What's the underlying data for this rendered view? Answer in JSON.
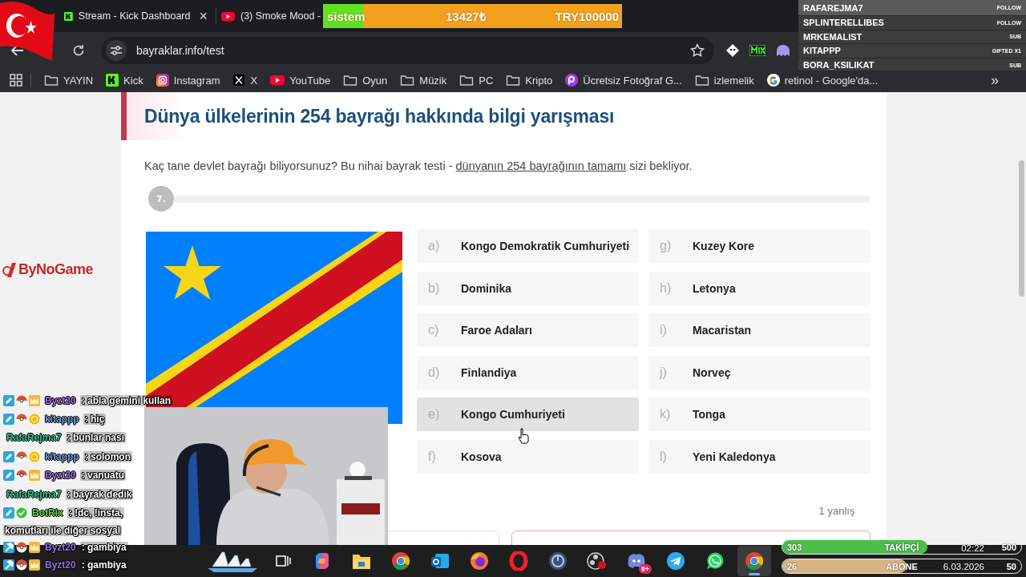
{
  "browser": {
    "tabs": [
      {
        "title": "Stream - Kick Dashboard",
        "close": "×",
        "kind": "kick"
      },
      {
        "title": "(3) Smoke Mood -",
        "kind": "youtube"
      }
    ],
    "address": "bayraklar.info/test",
    "bookmarks": [
      {
        "label": "YAYIN",
        "kind": "folder"
      },
      {
        "label": "Kick",
        "kind": "kick"
      },
      {
        "label": "Instagram",
        "kind": "instagram"
      },
      {
        "label": "X",
        "kind": "x"
      },
      {
        "label": "YouTube",
        "kind": "youtube"
      },
      {
        "label": "Oyun",
        "kind": "folder"
      },
      {
        "label": "Müzik",
        "kind": "folder"
      },
      {
        "label": "PC",
        "kind": "folder"
      },
      {
        "label": "Kripto",
        "kind": "folder"
      },
      {
        "label": "Ücretsiz Fotoğraf G...",
        "kind": "picsart"
      },
      {
        "label": "izlemelik",
        "kind": "folder"
      },
      {
        "label": "retinol - Google'da...",
        "kind": "google"
      }
    ],
    "more": "»"
  },
  "quiz": {
    "title": "Dünya ülkelerinin 254 bayrağı hakkında bilgi yarışması",
    "intro": "Kaç tane devlet bayrağı biliyorsunuz? Bu nihai bayrak testi - ",
    "intro_link": "dünyanın 254 bayrağının tamamı",
    "intro_end": " sizi bekliyor.",
    "step": "7.",
    "options": [
      {
        "letter": "a)",
        "name": "Kongo Demokratik Cumhuriyeti",
        "highlighted": false
      },
      {
        "letter": "b)",
        "name": "Dominika",
        "highlighted": false
      },
      {
        "letter": "c)",
        "name": "Faroe Adaları",
        "highlighted": false
      },
      {
        "letter": "d)",
        "name": "Finlandiya",
        "highlighted": false
      },
      {
        "letter": "e)",
        "name": "Kongo Cumhuriyeti",
        "highlighted": true
      },
      {
        "letter": "f)",
        "name": "Kosova",
        "highlighted": false
      },
      {
        "letter": "g)",
        "name": "Kuzey Kore",
        "highlighted": false
      },
      {
        "letter": "h)",
        "name": "Letonya",
        "highlighted": false
      },
      {
        "letter": "i)",
        "name": "Macaristan",
        "highlighted": false
      },
      {
        "letter": "j)",
        "name": "Norveç",
        "highlighted": false
      },
      {
        "letter": "k)",
        "name": "Tonga",
        "highlighted": false
      },
      {
        "letter": "l)",
        "name": "Yeni Kaledonya",
        "highlighted": false
      }
    ],
    "mistakes": "1 yanlış"
  },
  "taskbar": {
    "apps": [
      {
        "kind": "widget",
        "active": false
      },
      {
        "kind": "taskview",
        "active": false
      },
      {
        "kind": "copilot",
        "active": false
      },
      {
        "kind": "explorer",
        "active": false
      },
      {
        "kind": "chrome",
        "active": false
      },
      {
        "kind": "outlook",
        "active": false
      },
      {
        "kind": "firefox",
        "active": false
      },
      {
        "kind": "opera",
        "active": false
      },
      {
        "kind": "disc",
        "active": false
      },
      {
        "kind": "obs",
        "active": false
      },
      {
        "kind": "discord",
        "active": false,
        "badge": "9+"
      },
      {
        "kind": "telegram",
        "active": false
      },
      {
        "kind": "whatsapp",
        "active": false
      },
      {
        "kind": "chrome",
        "active": true
      }
    ],
    "time": "02:22",
    "date": "6.03.2026"
  },
  "overlay": {
    "goal": {
      "label": "sistem",
      "amount": "13427₺",
      "target": "TRY100000",
      "level": 0.134
    },
    "events": [
      {
        "name": "RAFAREJMA7",
        "type": "FOLLOW"
      },
      {
        "name": "SPLINTERELLIBES",
        "type": "FOLLOW"
      },
      {
        "name": "MRKEMALIST",
        "type": "SUB"
      },
      {
        "name": "KITAPPP",
        "type": "GIFTED X1"
      },
      {
        "name": "BORA_KSILIKAT",
        "type": "SUB"
      }
    ],
    "logo": "ByNoGame",
    "chat": [
      {
        "user": "Byzt20",
        "color": "#9a6fe0",
        "badges": [
          {
            "kind": "pencil"
          },
          {
            "kind": "ball"
          },
          {
            "kind": "crown"
          }
        ],
        "text": ": abla gemini kullan"
      },
      {
        "user": "kitappp",
        "color": "#6f9be0",
        "badges": [
          {
            "kind": "pencil"
          },
          {
            "kind": "ball"
          },
          {
            "kind": "coin"
          }
        ],
        "text": ": hiç"
      },
      {
        "user": "RafaRejma7",
        "color": "#3fbf8f",
        "text": ": bunlar nası"
      },
      {
        "user": "kitappp",
        "color": "#6f9be0",
        "badges": [
          {
            "kind": "pencil"
          },
          {
            "kind": "ball"
          },
          {
            "kind": "coin"
          }
        ],
        "text": ": solomon"
      },
      {
        "user": "Byzt20",
        "color": "#9a6fe0",
        "badges": [
          {
            "kind": "pencil"
          },
          {
            "kind": "ball"
          },
          {
            "kind": "crown"
          }
        ],
        "text": ": vanuatu"
      },
      {
        "user": "RafaRejma7",
        "color": "#3fbf8f",
        "text": ": bayrak dedik"
      },
      {
        "user": "BotRix",
        "color": "#5fd43a",
        "badges": [
          {
            "kind": "pencil"
          },
          {
            "kind": "check"
          }
        ],
        "text": ": !dc, !insta,",
        "continuation": "komutları ile diğer sosyal"
      },
      {
        "user": "Byzt20",
        "color": "#9a6fe0",
        "badges": [
          {
            "kind": "hammer"
          },
          {
            "kind": "ball"
          },
          {
            "kind": "crown"
          }
        ],
        "text": ": gambiya"
      },
      {
        "user": "Byzt20",
        "color": "#9a6fe0",
        "badges": [
          {
            "kind": "hammer"
          },
          {
            "kind": "ball"
          },
          {
            "kind": "crown"
          }
        ],
        "text": ": gambiya"
      }
    ],
    "bars": [
      {
        "count": "303",
        "label": "TAKİPÇİ",
        "target": "500",
        "level": 0.606,
        "color": "#4cbf4a"
      },
      {
        "count": "26",
        "label": "ABONE",
        "target": "50",
        "level": 0.52,
        "color": "#d6b583"
      }
    ]
  }
}
